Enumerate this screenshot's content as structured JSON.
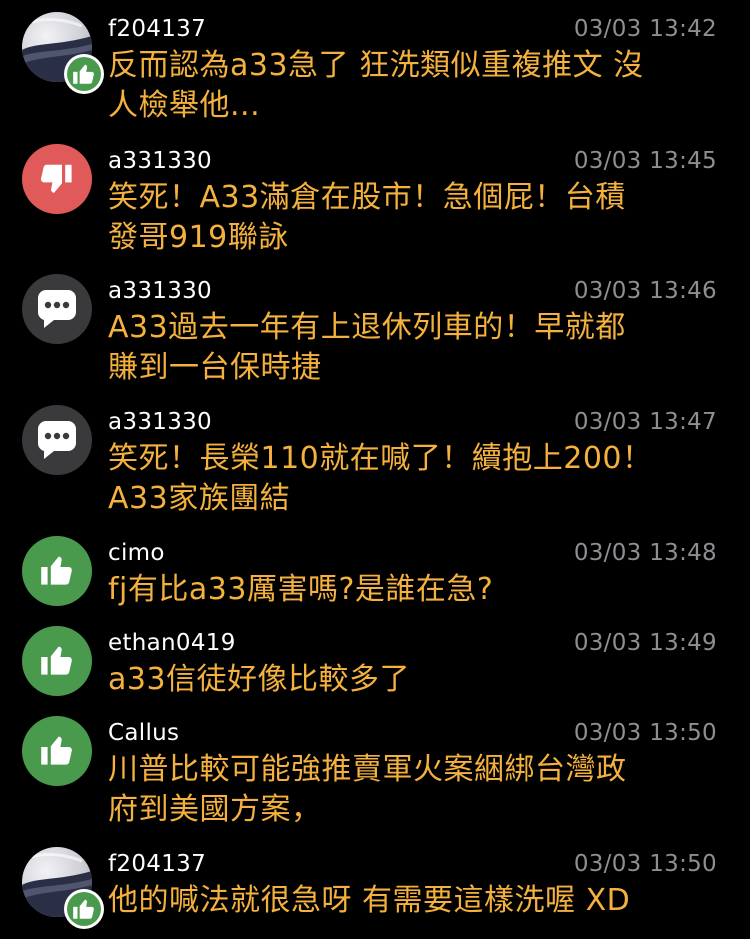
{
  "colors": {
    "background": "#000000",
    "username": "#ffffff",
    "timestamp": "#8e8e93",
    "content": "#f4b13d",
    "push_badge": "#4a9a4e",
    "boo_badge": "#e05a5a",
    "arrow_badge": "#3a3a3c"
  },
  "comments": [
    {
      "avatar": "user-photo-icon",
      "badge": "thumbs-up-icon",
      "user": "f204137",
      "time": "03/03 13:42",
      "lines": [
        "反而認為a33急了 狂洗類似重複推文 沒",
        "人檢舉他..."
      ]
    },
    {
      "avatar": "thumbs-down-icon",
      "user": "a331330",
      "time": "03/03 13:45",
      "lines": [
        "笑死！A33滿倉在股市！急個屁！台積",
        "發哥919聯詠"
      ]
    },
    {
      "avatar": "speech-bubble-icon",
      "user": "a331330",
      "time": "03/03 13:46",
      "lines": [
        "A33過去一年有上退休列車的！早就都",
        "賺到一台保時捷"
      ]
    },
    {
      "avatar": "speech-bubble-icon",
      "user": "a331330",
      "time": "03/03 13:47",
      "lines": [
        "笑死！長榮110就在喊了！續抱上200！",
        "A33家族團結"
      ]
    },
    {
      "avatar": "thumbs-up-icon",
      "user": "cimo",
      "time": "03/03 13:48",
      "lines": [
        "fj有比a33厲害嗎?是誰在急?"
      ]
    },
    {
      "avatar": "thumbs-up-icon",
      "user": "ethan0419",
      "time": "03/03 13:49",
      "lines": [
        "a33信徒好像比較多了"
      ]
    },
    {
      "avatar": "thumbs-up-icon",
      "user": "Callus",
      "time": "03/03 13:50",
      "lines": [
        "川普比較可能強推賣軍火案綑綁台灣政",
        "府到美國方案，"
      ]
    },
    {
      "avatar": "user-photo-icon",
      "badge": "thumbs-up-icon",
      "user": "f204137",
      "time": "03/03 13:50",
      "lines": [
        "他的喊法就很急呀 有需要這樣洗喔 XD"
      ]
    }
  ]
}
